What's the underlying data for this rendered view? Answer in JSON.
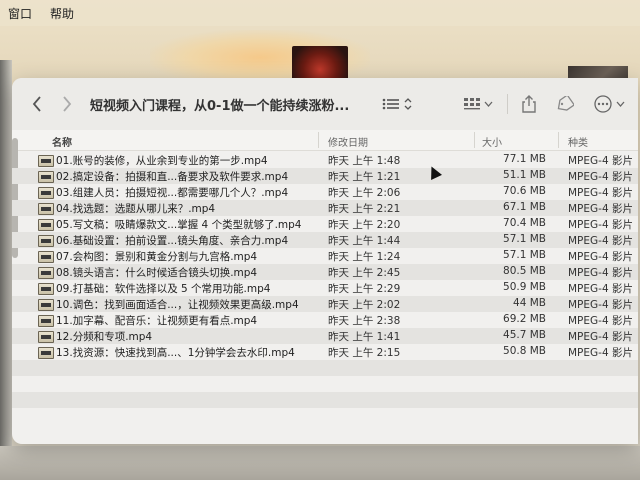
{
  "menubar": {
    "items": [
      "窗口",
      "帮助"
    ]
  },
  "window": {
    "title": "短视频入门课程，从0-1做一个能持续涨粉..."
  },
  "columns": {
    "name": "名称",
    "date": "修改日期",
    "size": "大小",
    "kind": "种类"
  },
  "files": [
    {
      "name": "01.账号的装修，从业余到专业的第一步.mp4",
      "date": "昨天 上午 1:48",
      "size": "77.1 MB",
      "kind": "MPEG-4 影片"
    },
    {
      "name": "02.搞定设备：拍摄和直...备要求及软件要求.mp4",
      "date": "昨天 上午 1:21",
      "size": "51.1 MB",
      "kind": "MPEG-4 影片"
    },
    {
      "name": "03.组建人员：拍摄短视...都需要哪几个人？.mp4",
      "date": "昨天 上午 2:06",
      "size": "70.6 MB",
      "kind": "MPEG-4 影片"
    },
    {
      "name": "04.找选题：选题从哪儿来？.mp4",
      "date": "昨天 上午 2:21",
      "size": "67.1 MB",
      "kind": "MPEG-4 影片"
    },
    {
      "name": "05.写文稿：吸睛爆款文...掌握 4 个类型就够了.mp4",
      "date": "昨天 上午 2:20",
      "size": "70.4 MB",
      "kind": "MPEG-4 影片"
    },
    {
      "name": "06.基础设置：拍前设置...镜头角度、亲合力.mp4",
      "date": "昨天 上午 1:44",
      "size": "57.1 MB",
      "kind": "MPEG-4 影片"
    },
    {
      "name": "07.会构图：景别和黄金分割与九宫格.mp4",
      "date": "昨天 上午 1:24",
      "size": "57.1 MB",
      "kind": "MPEG-4 影片"
    },
    {
      "name": "08.镜头语言：什么时候适合镜头切换.mp4",
      "date": "昨天 上午 2:45",
      "size": "80.5 MB",
      "kind": "MPEG-4 影片"
    },
    {
      "name": "09.打基础：软件选择以及 5 个常用功能.mp4",
      "date": "昨天 上午 2:29",
      "size": "50.9 MB",
      "kind": "MPEG-4 影片"
    },
    {
      "name": "10.调色：找到画面适合...，让视频效果更高级.mp4",
      "date": "昨天 上午 2:02",
      "size": "44 MB",
      "kind": "MPEG-4 影片"
    },
    {
      "name": "11.加字幕、配音乐：让视频更有看点.mp4",
      "date": "昨天 上午 2:38",
      "size": "69.2 MB",
      "kind": "MPEG-4 影片"
    },
    {
      "name": "12.分频和专项.mp4",
      "date": "昨天 上午 1:41",
      "size": "45.7 MB",
      "kind": "MPEG-4 影片"
    },
    {
      "name": "13.找资源：快速找到高...、1分钟学会去水印.mp4",
      "date": "昨天 上午 2:15",
      "size": "50.8 MB",
      "kind": "MPEG-4 影片"
    }
  ],
  "icons": {
    "back": "chevron-left-icon",
    "forward": "chevron-right-icon",
    "list_view": "list-view-icon",
    "grid_view": "grid-view-icon",
    "share": "share-icon",
    "tag": "tag-icon",
    "more": "ellipsis-icon"
  }
}
